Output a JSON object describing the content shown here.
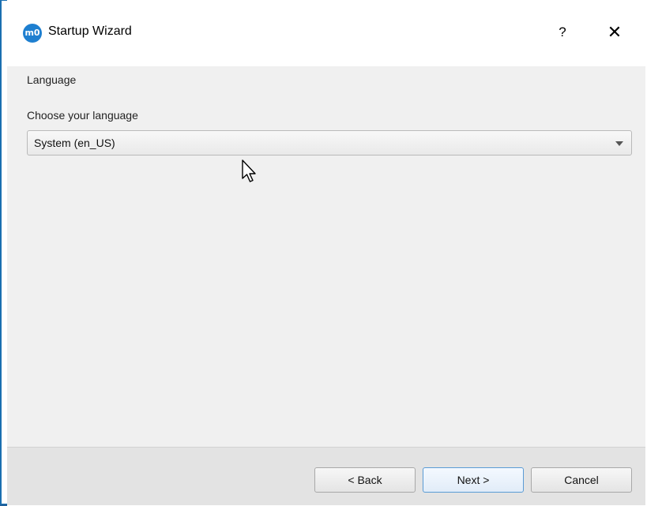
{
  "window": {
    "title": "Startup Wizard",
    "app_icon": "m0-logo-icon",
    "help_label": "?",
    "close_label": "✕"
  },
  "page": {
    "heading": "Language"
  },
  "language": {
    "label": "Choose your language",
    "selected": "System (en_US)"
  },
  "footer": {
    "back_label": "< Back",
    "next_label": "Next >",
    "cancel_label": "Cancel"
  },
  "colors": {
    "accent": "#1f5f9a",
    "icon_blue": "#1e7fd0",
    "primary_button_border": "#5a9bd5"
  }
}
